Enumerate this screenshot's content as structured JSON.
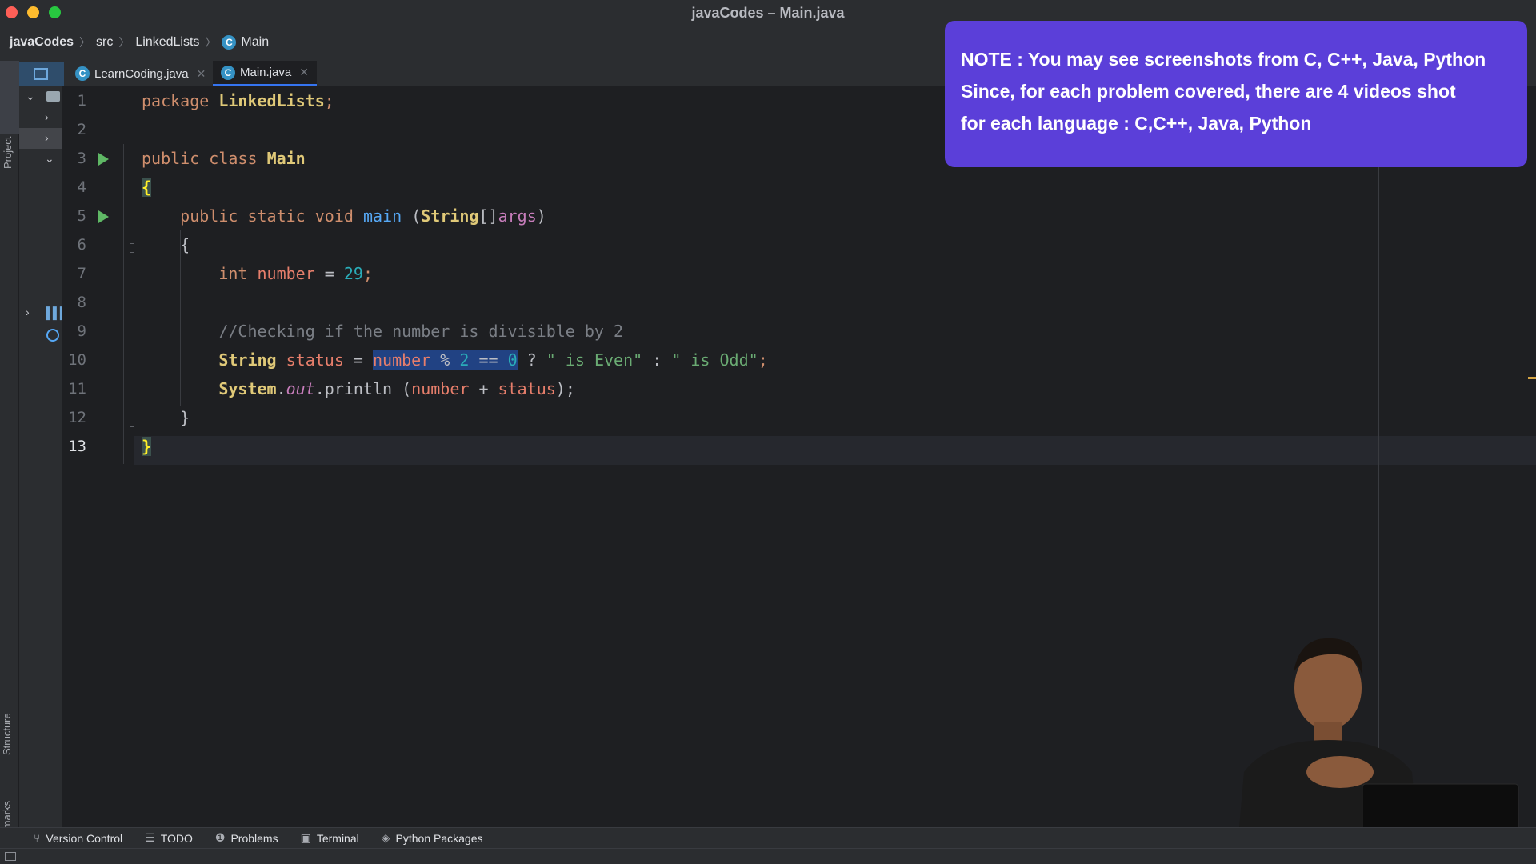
{
  "window": {
    "title": "javaCodes – Main.java"
  },
  "breadcrumb": {
    "items": [
      "javaCodes",
      "src",
      "LinkedLists",
      "Main"
    ],
    "class_icon": "C"
  },
  "tabs": [
    {
      "label": "LearnCoding.java",
      "icon": "C",
      "active": false
    },
    {
      "label": "Main.java",
      "icon": "C",
      "active": true
    }
  ],
  "tool_windows": {
    "project": "Project",
    "structure": "Structure",
    "bookmarks": "Bookmarks"
  },
  "editor": {
    "line_numbers": [
      "1",
      "2",
      "3",
      "4",
      "5",
      "6",
      "7",
      "8",
      "9",
      "10",
      "11",
      "12",
      "13"
    ],
    "current_line": 13,
    "code": {
      "l1_kw": "package",
      "l1_name": "LinkedLists",
      "l1_semi": ";",
      "l3_kw1": "public",
      "l3_kw2": "class",
      "l3_name": "Main",
      "l4_brace": "{",
      "l5_kw1": "public",
      "l5_kw2": "static",
      "l5_kw3": "void",
      "l5_fn": "main",
      "l5_open": " (",
      "l5_type": "String",
      "l5_arr": "[]",
      "l5_param": "args",
      "l5_close": ")",
      "l6_brace": "{",
      "l7_kw": "int",
      "l7_var": "number",
      "l7_eq": " = ",
      "l7_num": "29",
      "l7_semi": ";",
      "l9_comment": "//Checking if the number is divisible by 2",
      "l10_type": "String",
      "l10_var": "status",
      "l10_eq": " = ",
      "l10_v2": "number",
      "l10_mod": " % ",
      "l10_n2": "2",
      "l10_eqeq": " == ",
      "l10_n0": "0",
      "l10_q": " ? ",
      "l10_s1": "\" is Even\"",
      "l10_colon": " : ",
      "l10_s2": "\" is Odd\"",
      "l10_semi": ";",
      "l11_cls": "System",
      "l11_dot1": ".",
      "l11_out": "out",
      "l11_dot2": ".println (",
      "l11_v1": "number",
      "l11_plus": " + ",
      "l11_v2": "status",
      "l11_end": ");",
      "l12_brace": "}",
      "l13_brace": "}"
    }
  },
  "note": {
    "line1": "NOTE : You may see screenshots from C, C++, Java, Python",
    "line2": "Since, for each problem covered, there are 4 videos shot",
    "line3": "for each language : C,C++, Java, Python"
  },
  "bottom_tools": [
    {
      "label": "Version Control",
      "icon": "branch-icon"
    },
    {
      "label": "TODO",
      "icon": "list-icon"
    },
    {
      "label": "Problems",
      "icon": "info-icon"
    },
    {
      "label": "Terminal",
      "icon": "terminal-icon"
    },
    {
      "label": "Python Packages",
      "icon": "layers-icon"
    }
  ],
  "colors": {
    "accent": "#3574f0",
    "note_bg": "#5b3fd9",
    "run": "#5fb865"
  }
}
